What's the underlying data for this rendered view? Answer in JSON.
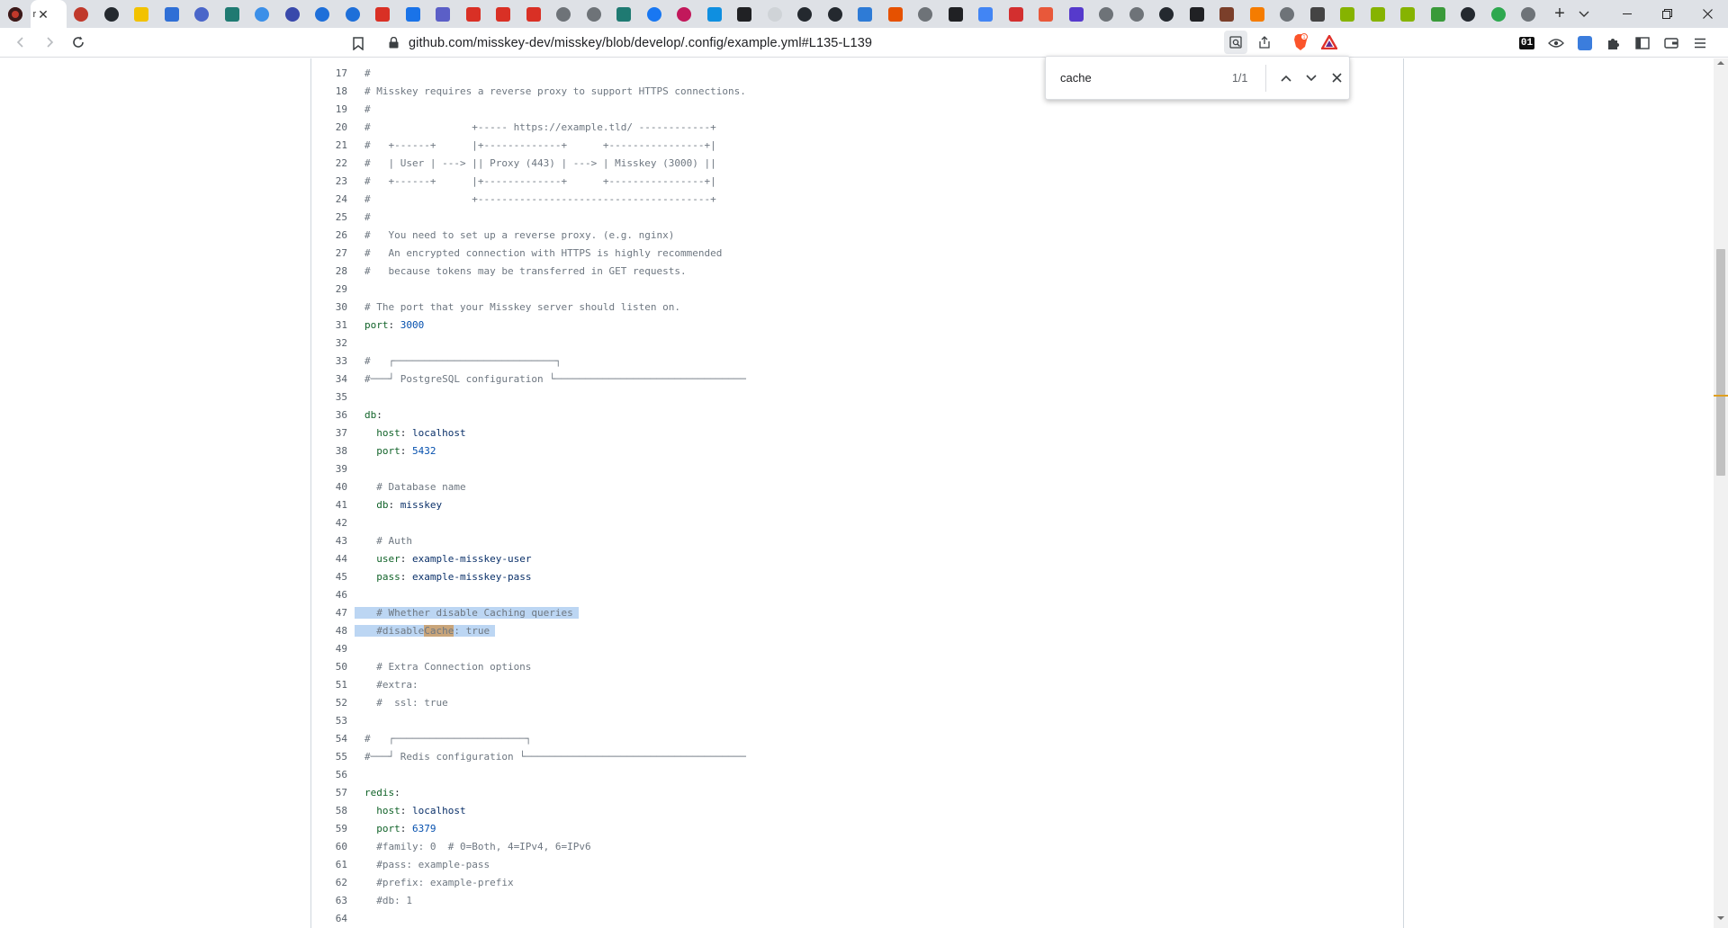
{
  "browser": {
    "active_tab_title": "r",
    "tab_count": 52,
    "url": "github.com/misskey-dev/misskey/blob/develop/.config/example.yml#L135-L139",
    "extension_badge": "01"
  },
  "find": {
    "query": "cache",
    "count": "1/1"
  },
  "code": {
    "lines": [
      {
        "n": "17",
        "t": "#"
      },
      {
        "n": "18",
        "t": "# Misskey requires a reverse proxy to support HTTPS connections."
      },
      {
        "n": "19",
        "t": "#"
      },
      {
        "n": "20",
        "t": "#                 +----- https://example.tld/ ------------+"
      },
      {
        "n": "21",
        "t": "#   +------+      |+-------------+      +----------------+|"
      },
      {
        "n": "22",
        "t": "#   | User | ---> || Proxy (443) | ---> | Misskey (3000) ||"
      },
      {
        "n": "23",
        "t": "#   +------+      |+-------------+      +----------------+|"
      },
      {
        "n": "24",
        "t": "#                 +---------------------------------------+"
      },
      {
        "n": "25",
        "t": "#"
      },
      {
        "n": "26",
        "t": "#   You need to set up a reverse proxy. (e.g. nginx)"
      },
      {
        "n": "27",
        "t": "#   An encrypted connection with HTTPS is highly recommended"
      },
      {
        "n": "28",
        "t": "#   because tokens may be transferred in GET requests."
      },
      {
        "n": "29",
        "t": ""
      },
      {
        "n": "30",
        "t": "# The port that your Misskey server should listen on."
      },
      {
        "n": "31",
        "t": "port: 3000"
      },
      {
        "n": "32",
        "t": ""
      },
      {
        "n": "33",
        "t": "#   ┌───────────────────────────┐"
      },
      {
        "n": "34",
        "t": "#───┘ PostgreSQL configuration └────────────────────────────────"
      },
      {
        "n": "35",
        "t": ""
      },
      {
        "n": "36",
        "t": "db:"
      },
      {
        "n": "37",
        "t": "  host: localhost"
      },
      {
        "n": "38",
        "t": "  port: 5432"
      },
      {
        "n": "39",
        "t": ""
      },
      {
        "n": "40",
        "t": "  # Database name"
      },
      {
        "n": "41",
        "t": "  db: misskey"
      },
      {
        "n": "42",
        "t": ""
      },
      {
        "n": "43",
        "t": "  # Auth"
      },
      {
        "n": "44",
        "t": "  user: example-misskey-user"
      },
      {
        "n": "45",
        "t": "  pass: example-misskey-pass"
      },
      {
        "n": "46",
        "t": ""
      },
      {
        "n": "47",
        "t": "  # Whether disable Caching queries"
      },
      {
        "n": "48",
        "t": "  #disableCache: true"
      },
      {
        "n": "49",
        "t": ""
      },
      {
        "n": "50",
        "t": "  # Extra Connection options"
      },
      {
        "n": "51",
        "t": "  #extra:"
      },
      {
        "n": "52",
        "t": "  #  ssl: true"
      },
      {
        "n": "53",
        "t": ""
      },
      {
        "n": "54",
        "t": "#   ┌──────────────────────┐"
      },
      {
        "n": "55",
        "t": "#───┘ Redis configuration └─────────────────────────────────────"
      },
      {
        "n": "56",
        "t": ""
      },
      {
        "n": "57",
        "t": "redis:"
      },
      {
        "n": "58",
        "t": "  host: localhost"
      },
      {
        "n": "59",
        "t": "  port: 6379"
      },
      {
        "n": "60",
        "t": "  #family: 0  # 0=Both, 4=IPv4, 6=IPv6"
      },
      {
        "n": "61",
        "t": "  #pass: example-pass"
      },
      {
        "n": "62",
        "t": "  #prefix: example-prefix"
      },
      {
        "n": "63",
        "t": "  #db: 1"
      },
      {
        "n": "64",
        "t": ""
      }
    ],
    "selected_lines": [
      "47",
      "48"
    ],
    "search_hit": {
      "line": "48",
      "text": "Cache"
    }
  },
  "colors": {
    "selection": "#bcd6f3",
    "search_hit": "#c9a57a",
    "comment": "#6e7781",
    "key": "#116329",
    "string": "#0a3069",
    "number": "#0550ae"
  },
  "tab_favicons": [
    {
      "name": "recorder-icon",
      "color": "#c0392b",
      "round": true
    },
    {
      "name": "github-icon",
      "color": "#24292f",
      "round": true
    },
    {
      "name": "notes-icon",
      "color": "#f2c200",
      "round": false
    },
    {
      "name": "docs-icon",
      "color": "#2f6fd6",
      "round": false
    },
    {
      "name": "nodes-icon",
      "color": "#4a66c9",
      "round": true
    },
    {
      "name": "green-k-icon",
      "color": "#1f7a72",
      "round": false
    },
    {
      "name": "n-icon",
      "color": "#3b8fe8",
      "round": true
    },
    {
      "name": "gear-blue-icon",
      "color": "#3949ab",
      "round": true
    },
    {
      "name": "refresh-icon",
      "color": "#1e6fd9",
      "round": true
    },
    {
      "name": "refresh2-icon",
      "color": "#1e6fd9",
      "round": true
    },
    {
      "name": "gmail-icon",
      "color": "#d93025",
      "round": false
    },
    {
      "name": "calendar-icon",
      "color": "#1a73e8",
      "round": false
    },
    {
      "name": "teams-icon",
      "color": "#5b5fc7",
      "round": false
    },
    {
      "name": "gmail2-icon",
      "color": "#d93025",
      "round": false
    },
    {
      "name": "gmail3-icon",
      "color": "#d93025",
      "round": false
    },
    {
      "name": "gmail4-icon",
      "color": "#d93025",
      "round": false
    },
    {
      "name": "globe-icon",
      "color": "#6e7378",
      "round": true
    },
    {
      "name": "globe2-icon",
      "color": "#6e7378",
      "round": true
    },
    {
      "name": "green-k2-icon",
      "color": "#1f7a72",
      "round": false
    },
    {
      "name": "facebook-icon",
      "color": "#1877f2",
      "round": true
    },
    {
      "name": "tracker-icon",
      "color": "#c2185b",
      "round": true
    },
    {
      "name": "p-icon",
      "color": "#0f8fe0",
      "round": false
    },
    {
      "name": "doc-black-icon",
      "color": "#202124",
      "round": false
    },
    {
      "name": "cloud-icon",
      "color": "#cfd3d7",
      "round": true
    },
    {
      "name": "github2-icon",
      "color": "#24292f",
      "round": true
    },
    {
      "name": "github3-icon",
      "color": "#24292f",
      "round": true
    },
    {
      "name": "mastodon-icon",
      "color": "#2e7bd6",
      "round": false
    },
    {
      "name": "h-icon",
      "color": "#e65100",
      "round": false
    },
    {
      "name": "globe3-icon",
      "color": "#6e7378",
      "round": true
    },
    {
      "name": "doc-black2-icon",
      "color": "#202124",
      "round": false
    },
    {
      "name": "translate-icon",
      "color": "#4285f4",
      "round": false
    },
    {
      "name": "red24-icon",
      "color": "#d32f2f",
      "round": false
    },
    {
      "name": "orange-icon",
      "color": "#e8583a",
      "round": false
    },
    {
      "name": "mastodon2-icon",
      "color": "#563acc",
      "round": false
    },
    {
      "name": "globe4-icon",
      "color": "#6e7378",
      "round": true
    },
    {
      "name": "globe5-icon",
      "color": "#6e7378",
      "round": true
    },
    {
      "name": "github4-icon",
      "color": "#24292f",
      "round": true
    },
    {
      "name": "doc-black3-icon",
      "color": "#202124",
      "round": false
    },
    {
      "name": "books-icon",
      "color": "#7b3f2a",
      "round": false
    },
    {
      "name": "blogger-icon",
      "color": "#f57c00",
      "round": false
    },
    {
      "name": "globe6-icon",
      "color": "#6e7378",
      "round": true
    },
    {
      "name": "wikipedia-icon",
      "color": "#444444",
      "round": false
    },
    {
      "name": "misskey-icon",
      "color": "#86b300",
      "round": false
    },
    {
      "name": "misskey2-icon",
      "color": "#86b300",
      "round": false
    },
    {
      "name": "misskey3-icon",
      "color": "#86b300",
      "round": false
    },
    {
      "name": "leaf-icon",
      "color": "#3a9a3a",
      "round": false
    },
    {
      "name": "github5-icon",
      "color": "#24292f",
      "round": true
    },
    {
      "name": "link-green-icon",
      "color": "#2ea84f",
      "round": true
    },
    {
      "name": "globe7-icon",
      "color": "#6e7378",
      "round": true
    }
  ]
}
